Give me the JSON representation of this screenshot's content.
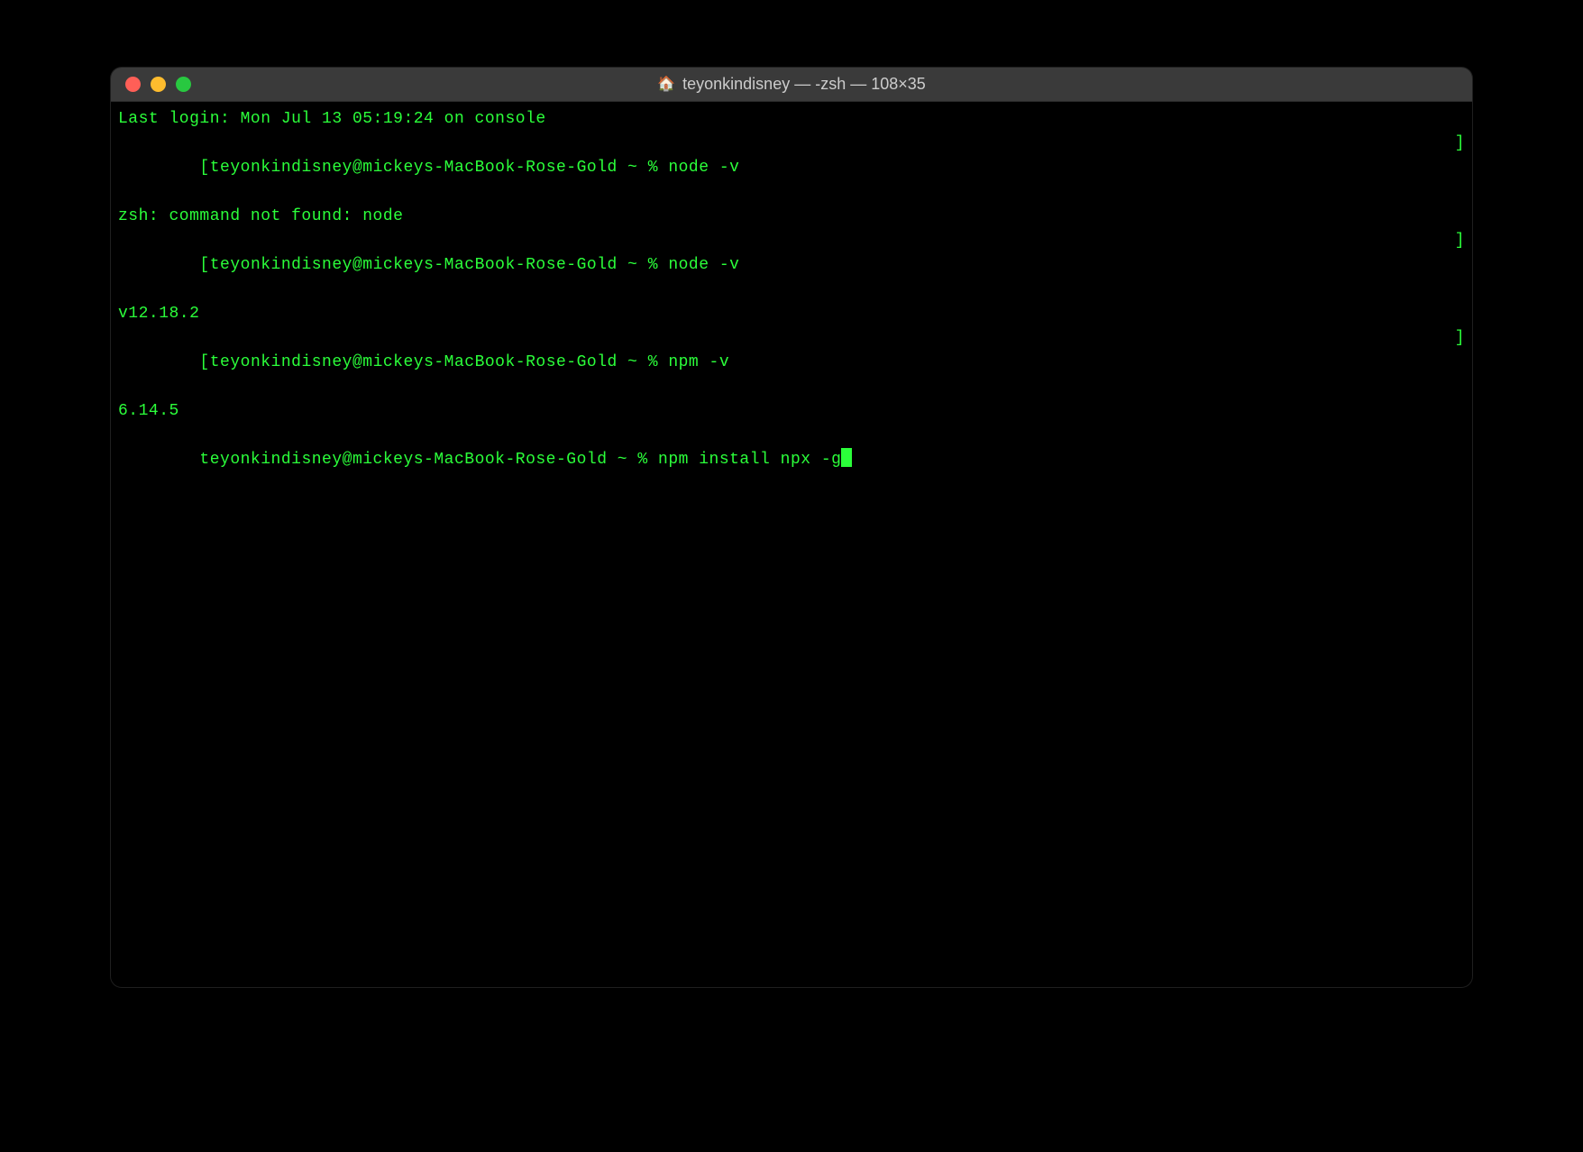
{
  "window": {
    "title": "teyonkindisney — -zsh — 108×35"
  },
  "terminal": {
    "last_login": "Last login: Mon Jul 13 05:19:24 on console",
    "prompt_open": "[",
    "prompt_close": "]",
    "prompt_text": "teyonkindisney@mickeys-MacBook-Rose-Gold ~ % ",
    "lines": {
      "cmd1": "node -v",
      "out1": "zsh: command not found: node",
      "cmd2": "node -v",
      "out2": "v12.18.2",
      "cmd3": "npm -v",
      "out3": "6.14.5",
      "cmd4": "npm install npx -g"
    }
  }
}
